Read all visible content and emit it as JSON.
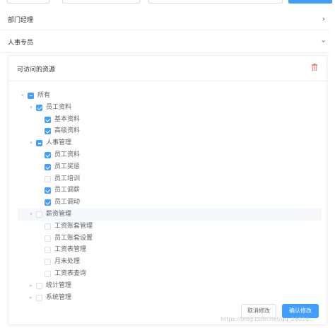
{
  "sections": [
    {
      "title": "部门经理",
      "expanded": false,
      "arrow_icon": "chevron-right-icon"
    },
    {
      "title": "人事专员",
      "expanded": true,
      "arrow_icon": "chevron-down-icon"
    }
  ],
  "card": {
    "title": "可访问的资源",
    "delete_icon": "trash-icon",
    "delete_icon_color": "#f56c6c"
  },
  "tree": [
    {
      "label": "所有",
      "level": 0,
      "state": "indeterminate",
      "caret": "down"
    },
    {
      "label": "员工资料",
      "level": 1,
      "state": "checked",
      "caret": "down"
    },
    {
      "label": "基本资料",
      "level": 2,
      "state": "checked",
      "caret": "none"
    },
    {
      "label": "高级资料",
      "level": 2,
      "state": "checked",
      "caret": "none"
    },
    {
      "label": "人事管理",
      "level": 1,
      "state": "indeterminate",
      "caret": "down"
    },
    {
      "label": "员工资料",
      "level": 2,
      "state": "checked",
      "caret": "none"
    },
    {
      "label": "员工奖惩",
      "level": 2,
      "state": "checked",
      "caret": "none"
    },
    {
      "label": "员工培训",
      "level": 2,
      "state": "unchecked",
      "caret": "none"
    },
    {
      "label": "员工调薪",
      "level": 2,
      "state": "checked",
      "caret": "none"
    },
    {
      "label": "员工调动",
      "level": 2,
      "state": "checked",
      "caret": "none"
    },
    {
      "label": "薪资管理",
      "level": 1,
      "state": "unchecked",
      "caret": "down",
      "highlight": true
    },
    {
      "label": "工资账套管理",
      "level": 2,
      "state": "unchecked",
      "caret": "none"
    },
    {
      "label": "员工账套设置",
      "level": 2,
      "state": "unchecked",
      "caret": "none"
    },
    {
      "label": "工资表管理",
      "level": 2,
      "state": "unchecked",
      "caret": "none"
    },
    {
      "label": "月末处理",
      "level": 2,
      "state": "unchecked",
      "caret": "none"
    },
    {
      "label": "工资表查询",
      "level": 2,
      "state": "unchecked",
      "caret": "none"
    },
    {
      "label": "统计管理",
      "level": 1,
      "state": "unchecked",
      "caret": "right"
    },
    {
      "label": "系统管理",
      "level": 1,
      "state": "unchecked",
      "caret": "right"
    }
  ],
  "buttons": {
    "cancel": "取消修改",
    "confirm": "确认修改"
  },
  "colors": {
    "primary": "#409eff",
    "border": "#dcdfe6",
    "text": "#606266",
    "danger": "#f56c6c"
  },
  "watermark": "https://blog.csdn.net/qq_26026..."
}
